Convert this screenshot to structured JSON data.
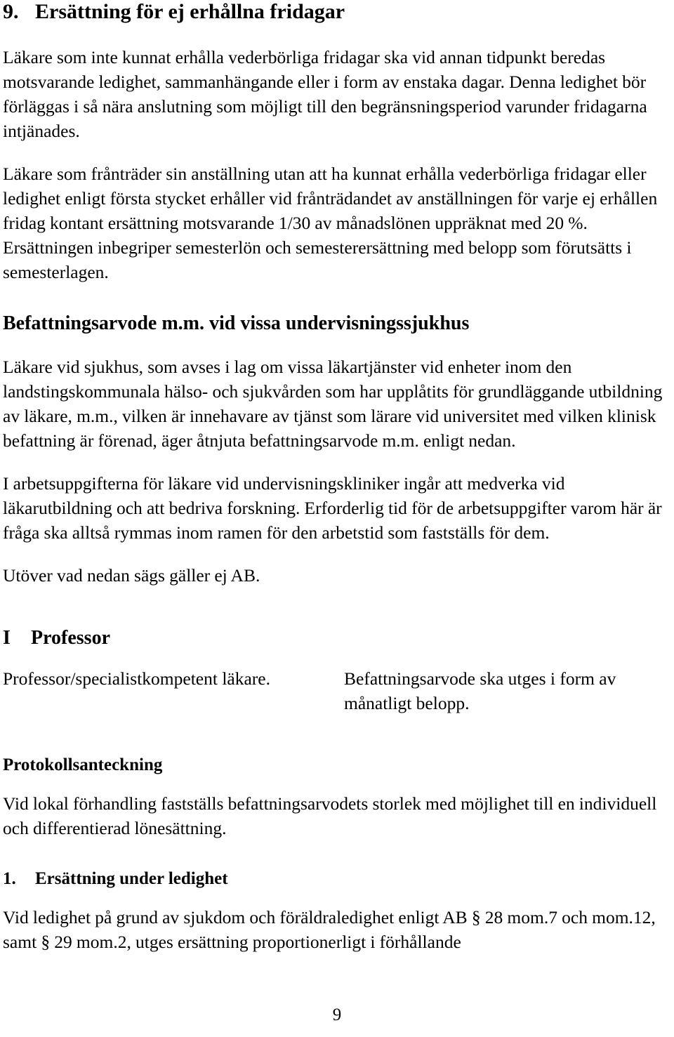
{
  "document": {
    "page_number": "9",
    "language": "sv"
  },
  "section": {
    "number": "9.",
    "title": "Ersättning för ej erhållna fridagar",
    "paragraphs": [
      "Läkare som inte kunnat erhålla vederbörliga fridagar ska vid annan tidpunkt beredas motsvarande ledighet, sammanhängande eller i form av enstaka dagar. Denna ledighet bör förläggas i så nära anslutning som möjligt till den begränsningsperiod varunder fridagarna intjänades.",
      "Läkare som frånträder sin anställning utan att ha kunnat erhålla vederbörliga fridagar eller ledighet enligt första stycket erhåller vid frånträdandet av anställningen för varje ej erhållen fridag kontant ersättning motsvarande 1/30 av månadslönen uppräknat med 20 %. Ersättningen inbegriper semesterlön och semesterersättning med belopp som förutsätts i semesterlagen."
    ]
  },
  "subsection": {
    "title": "Befattningsarvode m.m. vid vissa undervisningssjukhus",
    "paragraphs": [
      "Läkare vid sjukhus, som avses i lag om vissa läkartjänster vid enheter inom den landstingskommunala hälso- och sjukvården som har upplåtits för grundläggande utbildning av läkare, m.m., vilken är innehavare av tjänst som lärare vid universitet med vilken klinisk befattning är förenad, äger åtnjuta befattningsarvode m.m. enligt nedan.",
      "I arbetsuppgifterna för läkare vid undervisningskliniker ingår att medverka vid läkarutbildning och att bedriva forskning. Erforderlig tid för de arbetsuppgifter varom här är fråga ska alltså rymmas inom ramen för den arbetstid som fastställs för dem.",
      "Utöver vad nedan sägs gäller ej AB."
    ]
  },
  "professor_section": {
    "number": "I",
    "title": "Professor",
    "row": {
      "left": "Professor/specialistkompetent läkare.",
      "right": "Befattningsarvode ska utges i form av månatligt belopp."
    }
  },
  "protocol_note": {
    "title": "Protokollsanteckning",
    "paragraph": "Vid lokal förhandling fastställs befattningsarvodets storlek med möjlighet till en individuell och differentierad lönesättning."
  },
  "item_1": {
    "number": "1.",
    "title": "Ersättning under ledighet",
    "paragraph": "Vid ledighet på grund av sjukdom och föräldraledighet enligt AB § 28 mom.7 och mom.12, samt § 29 mom.2, utges ersättning proportionerligt i förhållande"
  }
}
